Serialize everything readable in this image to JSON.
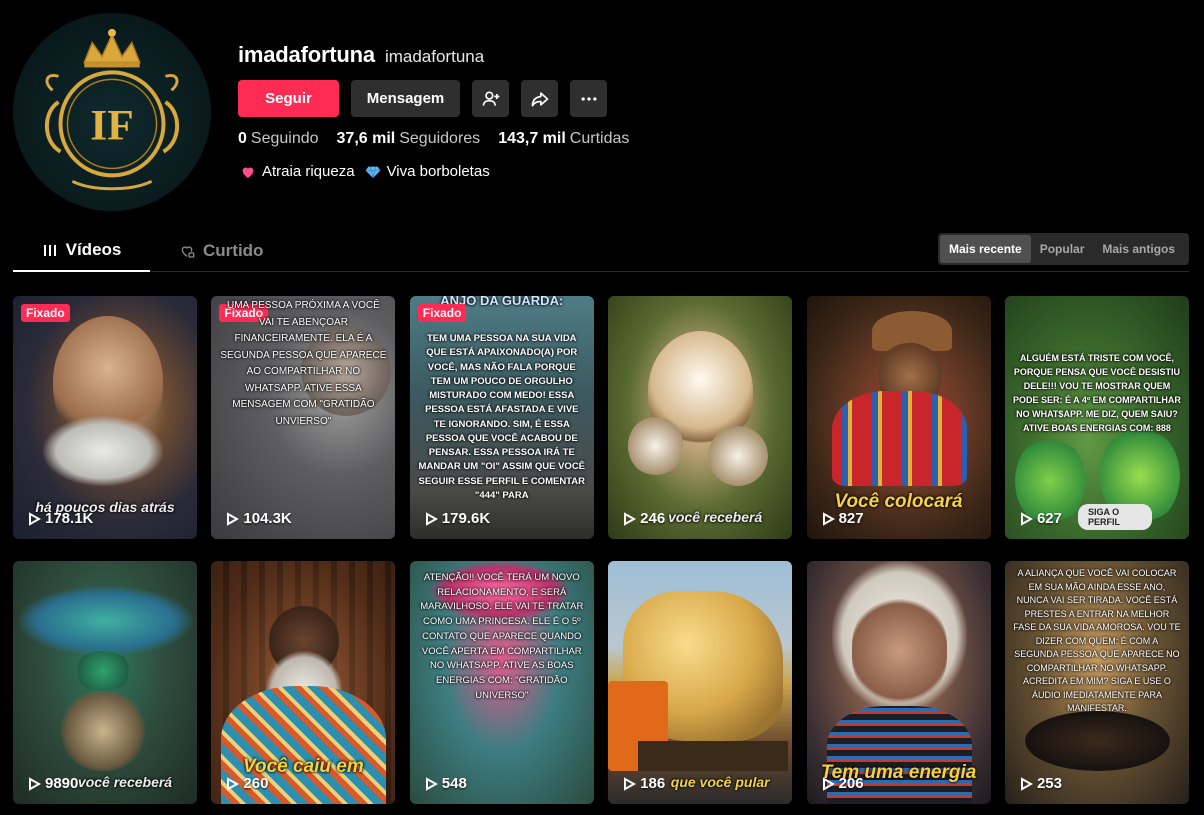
{
  "profile": {
    "username": "imadafortuna",
    "nickname": "imadafortuna",
    "avatar_monogram": "IF",
    "follow_label": "Seguir",
    "message_label": "Mensagem",
    "stats": [
      {
        "value": "0",
        "label": "Seguindo"
      },
      {
        "value": "37,6 mil",
        "label": "Seguidores"
      },
      {
        "value": "143,7 mil",
        "label": "Curtidas"
      }
    ],
    "bio_part1": "Atraia riqueza",
    "bio_part2": "Viva borboletas"
  },
  "tabs": {
    "videos": "Vídeos",
    "liked": "Curtido"
  },
  "sort": {
    "recent": "Mais recente",
    "popular": "Popular",
    "oldest": "Mais antigos"
  },
  "pinned_label": "Fixado",
  "videos": [
    {
      "views": "178.1K",
      "pinned": true,
      "caption": "há poucos dias atrás"
    },
    {
      "views": "104.3K",
      "pinned": true,
      "text": "UMA PESSOA PRÓXIMA A VOCÊ VAI TE ABENÇOAR FINANCEIRAMENTE. ELA É A SEGUNDA PESSOA QUE APARECE AO COMPARTILHAR NO WHATSAPP. ATIVE ESSA MENSAGEM COM \"GRATIDÃO UNVIERSO\""
    },
    {
      "views": "179.6K",
      "pinned": true,
      "heading": "ANJO DA GUARDA:",
      "text": "TEM UMA PESSOA NA SUA VIDA QUE ESTÁ APAIXONADO(A) POR VOCÊ, MAS NÃO FALA PORQUE TEM UM POUCO DE ORGULHO MISTURADO COM MEDO! ESSA PESSOA ESTÁ AFASTADA E VIVE TE IGNORANDO. SIM, É ESSA PESSOA QUE VOCÊ ACABOU DE PENSAR. ESSA PESSOA IRÁ TE MANDAR UM \"OI\" ASSIM QUE VOCÊ SEGUIR ESSE PERFIL E COMENTAR \"444\" PARA"
    },
    {
      "views": "246",
      "caption": "você receberá"
    },
    {
      "views": "827",
      "caption": "Você colocará"
    },
    {
      "views": "627",
      "text": "ALGUÉM ESTÁ TRISTE COM VOCÊ, PORQUE PENSA QUE VOCÊ DESISTIU DELE!!! VOU TE MOSTRAR QUEM PODE SER: É A 4º EM COMPARTILHAR NO WHAT$APP. ME DIZ, QUEM SAIU? ATIVE BOAS ENERGIAS COM: 888",
      "pill": "SIGA O PERFIL"
    },
    {
      "views": "9890",
      "caption": "você receberá"
    },
    {
      "views": "260",
      "caption": "Você caiu em"
    },
    {
      "views": "548",
      "text": "ATENÇÃO!! VOCÊ TERÁ UM NOVO RELACIONAMENTO, E SERÁ MARAVILHOSO. ELE VAI TE TRATAR COMO UMA PRINCESA. ELE É O 5º CoNTATo QUE APARECE QUANDO VOCÊ APERTA EM CoMPARTILHAR NO WHATSAPP. ATIVE AS BOAS ENERGIAS COM: \"GRATIDÃO UNIVERSO\""
    },
    {
      "views": "186",
      "caption": "que você pular"
    },
    {
      "views": "206",
      "caption": "Tem uma energia"
    },
    {
      "views": "253",
      "text": "A ALIANÇA QUE VOCÊ VAI COLOCAR EM SUA MÃO AINDA ESSE ANO, NUNCA VAI SER TIRADA. VOCÊ ESTÁ PRESTES A ENTRAR NA MELHOR FASE DA SUA VIDA AMOROSA. VOU TE DIZER COM QUEM: É COM A SEGUNDA PESSOA QUE APARECE NO COMPARTILHAR NO WHATSAPP. ACREDITA EM MIM? SIGA E USE O ÁUDIO IMEDIATAMENTE PARA MANIFESTAR."
    }
  ],
  "colors": {
    "accent": "#fe2c55",
    "button_dark": "#2f2f2f",
    "caption_gold": "#f5d23f"
  }
}
